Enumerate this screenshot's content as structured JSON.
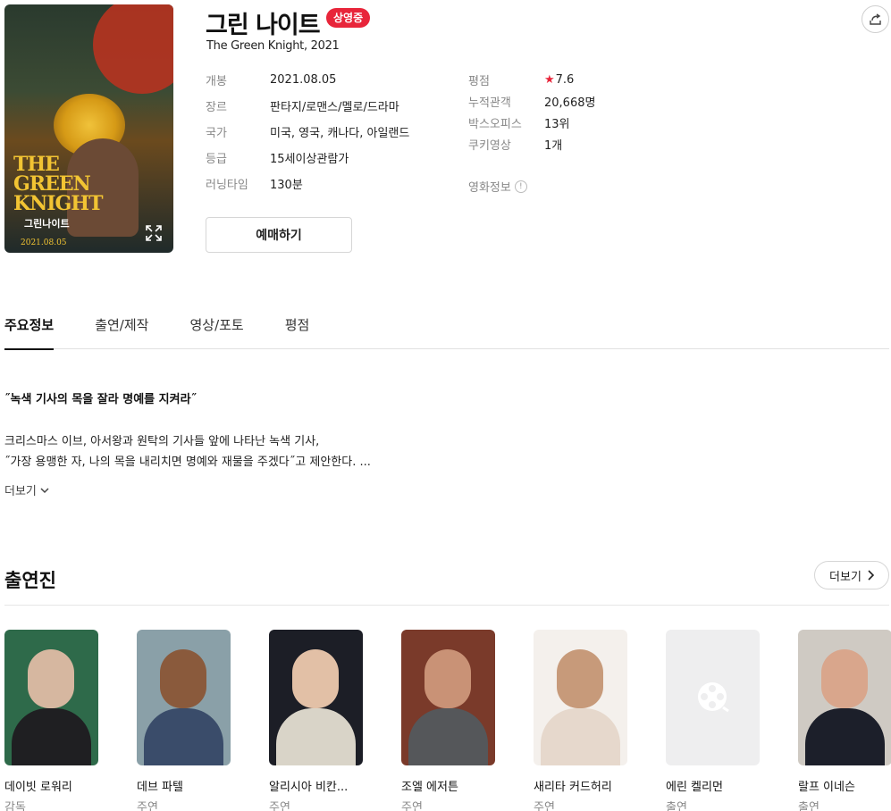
{
  "movie": {
    "title": "그린 나이트",
    "status_badge": "상영중",
    "subtitle": "The Green Knight, 2021",
    "poster_title": "THE GREEN KNIGHT",
    "poster_subtitle": "그린나이트",
    "poster_date": "2021.08.05"
  },
  "info_left": [
    {
      "key": "개봉",
      "value": "2021.08.05"
    },
    {
      "key": "장르",
      "value": "판타지/로맨스/멜로/드라마"
    },
    {
      "key": "국가",
      "value": "미국, 영국, 캐나다, 아일랜드"
    },
    {
      "key": "등급",
      "value": "15세이상관람가"
    },
    {
      "key": "러닝타임",
      "value": "130분"
    }
  ],
  "info_right": {
    "rating_key": "평점",
    "rating_value": "7.6",
    "audience_key": "누적관객",
    "audience_value": "20,668명",
    "boxoffice_key": "박스오피스",
    "boxoffice_value": "13위",
    "cookie_key": "쿠키영상",
    "cookie_value": "1개",
    "movie_info_label": "영화정보"
  },
  "book_button": "예매하기",
  "tabs": [
    "주요정보",
    "출연/제작",
    "영상/포토",
    "평점"
  ],
  "tagline": "˝녹색 기사의 목을 잘라 명예를 지켜라˝",
  "synopsis": {
    "line1": "크리스마스 이브, 아서왕과 원탁의 기사들 앞에 나타난 녹색 기사,",
    "line2": "˝가장 용맹한 자, 나의 목을 내리치면 명예와 재물을 주겠다˝고 제안한다. ..."
  },
  "more_label": "더보기",
  "cast": {
    "title": "출연진",
    "more_label": "더보기",
    "members": [
      {
        "name": "데이빗 로워리",
        "role": "감독",
        "bg": "#2e6a4a",
        "skin": "#d6b7a0",
        "suit": "#1f1f22"
      },
      {
        "name": "데브 파텔",
        "role": "주연",
        "bg": "#8aa0a8",
        "skin": "#8a5a3c",
        "suit": "#3a4c6a"
      },
      {
        "name": "알리시아 비칸...",
        "role": "주연",
        "bg": "#1c1e26",
        "skin": "#e2c0a6",
        "suit": "#d9d4c8"
      },
      {
        "name": "조엘 에저튼",
        "role": "주연",
        "bg": "#7a3a2a",
        "skin": "#c99276",
        "suit": "#55575a"
      },
      {
        "name": "새리타 커드허리",
        "role": "주연",
        "bg": "#f4f0ec",
        "skin": "#c79a7a",
        "suit": "#e6d8cc"
      },
      {
        "name": "에린 켈리먼",
        "role": "출연",
        "placeholder": true
      },
      {
        "name": "랄프 이네슨",
        "role": "출연",
        "bg": "#cfcac3",
        "skin": "#d9a68c",
        "suit": "#1c1f2a"
      }
    ]
  }
}
